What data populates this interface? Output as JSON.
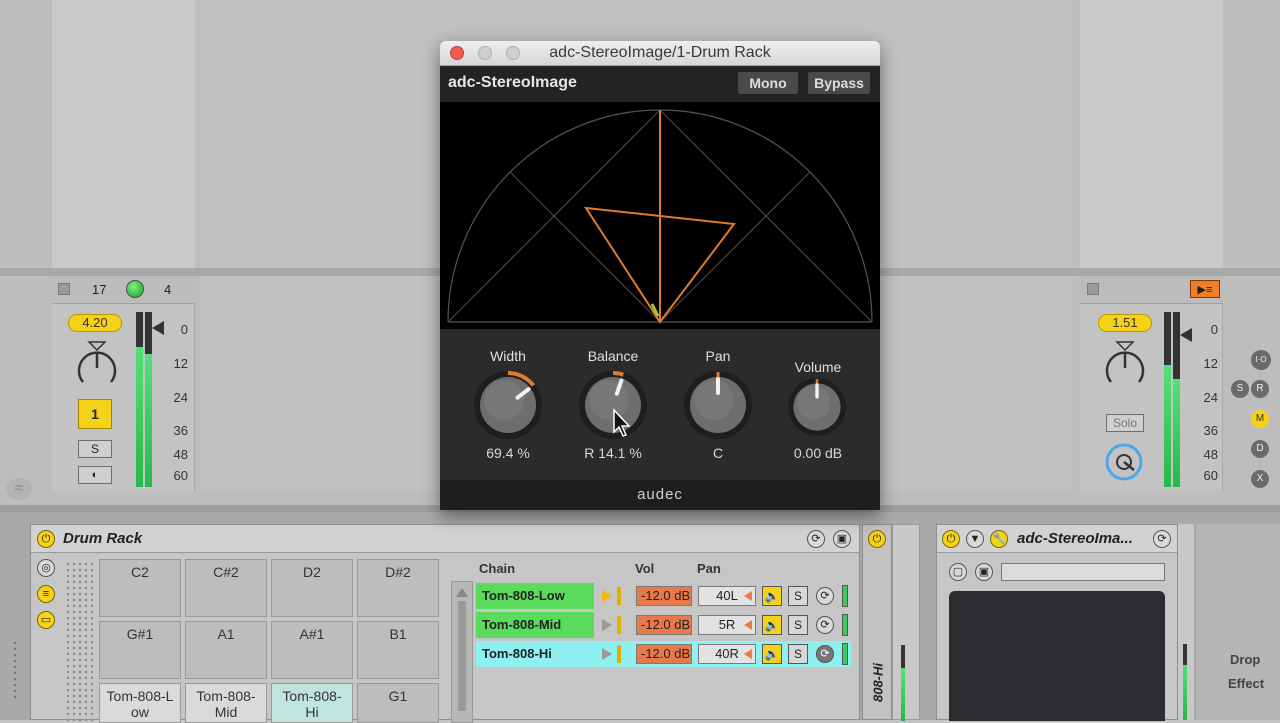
{
  "plugin_window": {
    "title": "adc-StereoImage/1-Drum Rack",
    "plugin_name": "adc-StereoImage",
    "mono_label": "Mono",
    "bypass_label": "Bypass",
    "brand": "audec",
    "knobs": [
      {
        "label": "Width",
        "value": "69.4 %",
        "level": 0.694
      },
      {
        "label": "Balance",
        "value": "R 14.1 %",
        "level": 0.57
      },
      {
        "label": "Pan",
        "value": "C",
        "level": 0.5
      },
      {
        "label": "Volume",
        "value": "0.00 dB",
        "level": 0.5
      }
    ]
  },
  "mixer_left": {
    "track_number": "17",
    "track_count": "4",
    "volume_value": "4.20",
    "track_button": "1",
    "solo_label": "S",
    "db_scale": [
      "0",
      "12",
      "24",
      "36",
      "48",
      "60"
    ]
  },
  "mixer_right": {
    "volume_value": "1.51",
    "solo_label": "Solo",
    "db_scale": [
      "0",
      "12",
      "24",
      "36",
      "48",
      "60"
    ],
    "side_buttons": [
      "I·O",
      "S",
      "R",
      "M",
      "D",
      "X"
    ]
  },
  "drum_rack": {
    "title": "Drum Rack",
    "pads": [
      {
        "label": "C2"
      },
      {
        "label": "C#2"
      },
      {
        "label": "D2"
      },
      {
        "label": "D#2"
      },
      {
        "label": "G#1"
      },
      {
        "label": "A1"
      },
      {
        "label": "A#1"
      },
      {
        "label": "B1"
      },
      {
        "label": "Tom-808-Low"
      },
      {
        "label": "Tom-808-Mid"
      },
      {
        "label": "Tom-808-Hi"
      },
      {
        "label": "G1"
      }
    ],
    "chain_headers": {
      "chain": "Chain",
      "vol": "Vol",
      "pan": "Pan"
    },
    "chains": [
      {
        "name": "Tom-808-Low",
        "vol": "-12.0 dB",
        "pan": "40L",
        "solo": "S"
      },
      {
        "name": "Tom-808-Mid",
        "vol": "-12.0 dB",
        "pan": "5R",
        "solo": "S"
      },
      {
        "name": "Tom-808-Hi",
        "vol": "-12.0 dB",
        "pan": "40R",
        "solo": "S"
      }
    ],
    "selected_chain_vertical": "808-Hi"
  },
  "stereo_device": {
    "title": "adc-StereoIma...",
    "drop_label_1": "Drop",
    "drop_label_2": "Effect"
  },
  "colors": {
    "accent_yellow": "#f5d218",
    "chain_green": "#5bdb5b",
    "chain_cyan": "#8ef0f0",
    "scope_line": "#e07b2a"
  }
}
